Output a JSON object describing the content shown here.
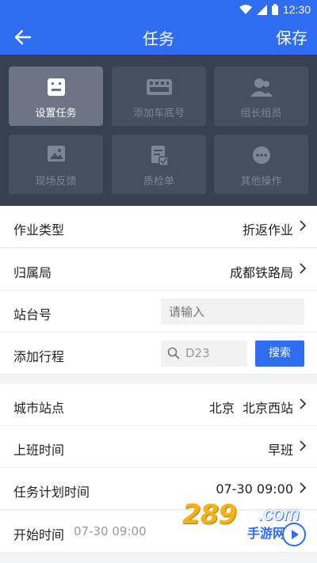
{
  "status_bar": {
    "time": "12:30"
  },
  "header": {
    "title": "任务",
    "save_label": "保存"
  },
  "tools": [
    {
      "label": "设置任务",
      "icon": "task-list-icon",
      "active": true
    },
    {
      "label": "添加车底号",
      "icon": "train-plate-icon",
      "active": false
    },
    {
      "label": "组长组员",
      "icon": "team-members-icon",
      "active": false
    },
    {
      "label": "现场反馈",
      "icon": "image-icon",
      "active": false
    },
    {
      "label": "质检单",
      "icon": "inspection-doc-icon",
      "active": false
    },
    {
      "label": "其他操作",
      "icon": "more-icon",
      "active": false
    }
  ],
  "form": {
    "work_type": {
      "label": "作业类型",
      "value": "折返作业"
    },
    "bureau": {
      "label": "归属局",
      "value": "成都铁路局"
    },
    "platform": {
      "label": "站台号",
      "placeholder": "请输入"
    },
    "trip": {
      "label": "添加行程",
      "search_text": "D23",
      "button": "搜索"
    },
    "station": {
      "label": "城市站点",
      "value": "北京  北京西站"
    },
    "shift": {
      "label": "上班时间",
      "value": "早班"
    },
    "plan_time": {
      "label": "任务计划时间",
      "value": "07-30 09:00"
    },
    "start_time": {
      "label": "开始时间",
      "value": "07-30 09:00"
    }
  },
  "watermark": {
    "brand": "289",
    "domain": ".com",
    "tagline": "手游网"
  },
  "colors": {
    "primary": "#2f6df2",
    "panel": "#374152",
    "tile": "#454f60",
    "tile_active": "#6d7585"
  }
}
